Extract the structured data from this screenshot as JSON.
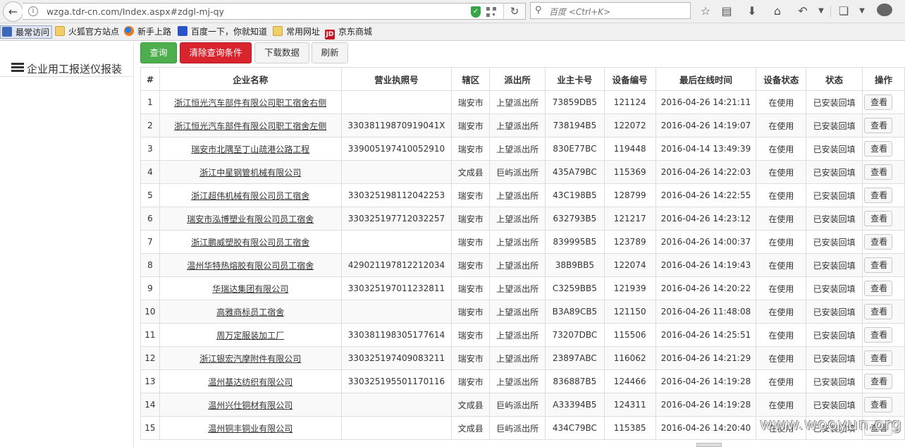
{
  "browser": {
    "url": "wzga.tdr-cn.com/Index.aspx#zdgl-mj-qy",
    "search_placeholder": "百度 <Ctrl+K>",
    "bookmarks": [
      "最常访问",
      "火狐官方站点",
      "新手上路",
      "百度一下，你就知道",
      "常用网址",
      "京东商城"
    ]
  },
  "sidebar": {
    "title": "企业用工报送仪报装"
  },
  "toolbar": {
    "query": "查询",
    "clear": "清除查询条件",
    "download": "下载数据",
    "refresh": "刷新"
  },
  "table": {
    "headers": [
      "#",
      "企业名称",
      "营业执照号",
      "辖区",
      "派出所",
      "业主卡号",
      "设备编号",
      "最后在线时间",
      "设备状态",
      "状态",
      "操作"
    ],
    "view_label": "查看",
    "rows": [
      [
        "1",
        "浙江恒光汽车部件有限公司职工宿舍右侧",
        "",
        "瑞安市",
        "上望派出所",
        "73859DB5",
        "121124",
        "2016-04-26 14:21:11",
        "在使用",
        "已安装回填"
      ],
      [
        "2",
        "浙江恒光汽车部件有限公司职工宿舍左侧",
        "33038119870919041X",
        "瑞安市",
        "上望派出所",
        "738194B5",
        "122072",
        "2016-04-26 14:19:07",
        "在使用",
        "已安装回填"
      ],
      [
        "3",
        "瑞安市北隅至丁山疏港公路工程",
        "339005197410052910",
        "瑞安市",
        "上望派出所",
        "830E77BC",
        "119448",
        "2016-04-14 13:49:39",
        "在使用",
        "已安装回填"
      ],
      [
        "4",
        "浙江中星钢管机械有限公司",
        "",
        "文成县",
        "巨屿派出所",
        "435A79BC",
        "115369",
        "2016-04-26 14:22:03",
        "在使用",
        "已安装回填"
      ],
      [
        "5",
        "浙江超伟机械有限公司员工宿舍",
        "330325198112042253",
        "瑞安市",
        "上望派出所",
        "43C198B5",
        "128799",
        "2016-04-26 14:22:55",
        "在使用",
        "已安装回填"
      ],
      [
        "6",
        "瑞安市泓博塑业有限公司员工宿舍",
        "330325197712032257",
        "瑞安市",
        "上望派出所",
        "632793B5",
        "121217",
        "2016-04-26 14:23:12",
        "在使用",
        "已安装回填"
      ],
      [
        "7",
        "浙江鹏威塑胶有限公司员工宿舍",
        "",
        "瑞安市",
        "上望派出所",
        "839995B5",
        "123789",
        "2016-04-26 14:00:37",
        "在使用",
        "已安装回填"
      ],
      [
        "8",
        "温州华特热熔胶有限公司员工宿舍",
        "429021197812212034",
        "瑞安市",
        "上望派出所",
        "38B9BB5",
        "122074",
        "2016-04-26 14:19:43",
        "在使用",
        "已安装回填"
      ],
      [
        "9",
        "华瑞达集团有限公司",
        "330325197011232811",
        "瑞安市",
        "上望派出所",
        "C3259BB5",
        "121939",
        "2016-04-26 14:20:22",
        "在使用",
        "已安装回填"
      ],
      [
        "10",
        "高雅商标员工宿舍",
        "",
        "瑞安市",
        "上望派出所",
        "B3A89CB5",
        "121150",
        "2016-04-26 11:48:08",
        "在使用",
        "已安装回填"
      ],
      [
        "11",
        "周万定服装加工厂",
        "330381198305177614",
        "瑞安市",
        "上望派出所",
        "73207DBC",
        "115506",
        "2016-04-26 14:25:51",
        "在使用",
        "已安装回填"
      ],
      [
        "12",
        "浙江银宏汽摩附件有限公司",
        "330325197409083211",
        "瑞安市",
        "上望派出所",
        "23897ABC",
        "116062",
        "2016-04-26 14:21:29",
        "在使用",
        "已安装回填"
      ],
      [
        "13",
        "温州基达纺织有限公司",
        "330325195501170116",
        "瑞安市",
        "上望派出所",
        "836887B5",
        "124466",
        "2016-04-26 14:19:28",
        "在使用",
        "已安装回填"
      ],
      [
        "14",
        "温州兴仕铜材有限公司",
        "",
        "文成县",
        "巨屿派出所",
        "A33394B5",
        "124311",
        "2016-04-26 14:19:28",
        "在使用",
        "已安装回填"
      ],
      [
        "15",
        "温州铜丰铜业有限公司",
        "",
        "文成县",
        "巨屿派出所",
        "434C79BC",
        "115385",
        "2016-04-26 14:20:40",
        "在使用",
        "已安装回填"
      ]
    ]
  },
  "watermark": "www.wooyun.org"
}
